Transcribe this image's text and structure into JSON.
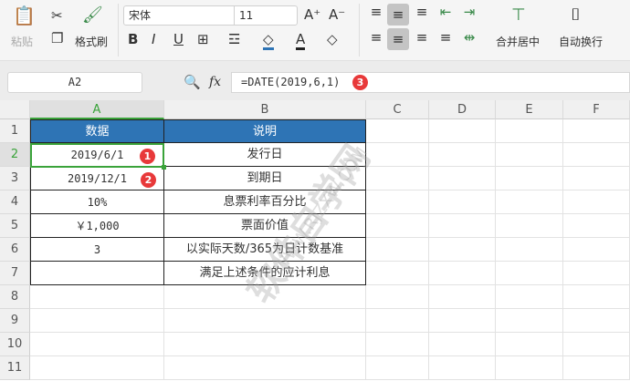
{
  "ribbon": {
    "paste": "粘贴",
    "format_painter": "格式刷",
    "font_name": "宋体",
    "font_size": "11",
    "merge_center": "合并居中",
    "wrap_text": "自动换行"
  },
  "formula_bar": {
    "name_box": "A2",
    "fx": "fx",
    "formula": "=DATE(2019,6,1)",
    "badge": "3"
  },
  "columns": [
    "A",
    "B",
    "C",
    "D",
    "E",
    "F"
  ],
  "rows": [
    "1",
    "2",
    "3",
    "4",
    "5",
    "6",
    "7",
    "8",
    "9",
    "10",
    "11"
  ],
  "table": {
    "header": [
      "数据",
      "说明"
    ],
    "rows": [
      [
        "2019/6/1",
        "发行日"
      ],
      [
        "2019/12/1",
        "到期日"
      ],
      [
        "10%",
        "息票利率百分比"
      ],
      [
        "￥1,000",
        "票面价值"
      ],
      [
        "3",
        "以实际天数/365为日计数基准"
      ],
      [
        "",
        "满足上述条件的应计利息"
      ]
    ]
  },
  "badges": [
    "1",
    "2"
  ],
  "watermark": {
    "cn": "软件自学网",
    "url": "WWW.RJZXW.COM"
  },
  "colors": {
    "header_fill": "#2e74b5",
    "selection": "#3aa33a",
    "badge": "#e8393a"
  }
}
